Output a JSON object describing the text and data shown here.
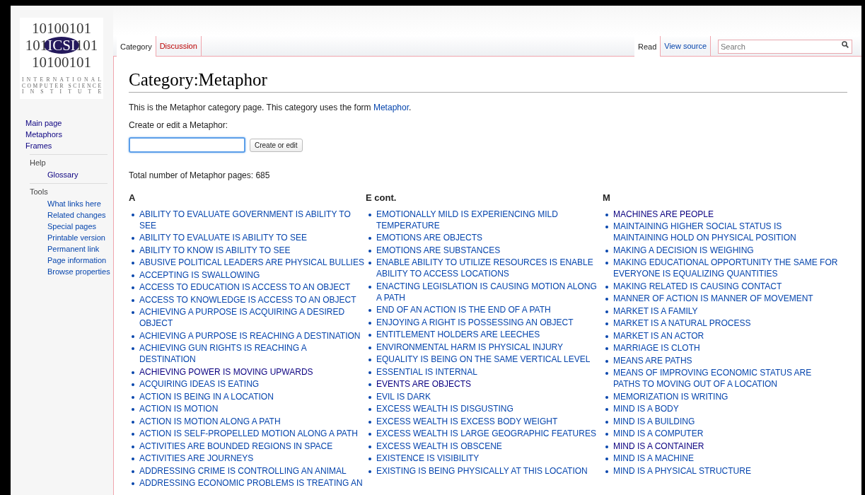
{
  "logo": {
    "rows": [
      "10100101",
      "10100101"
    ],
    "middle": [
      "101",
      "ICSI",
      "101"
    ],
    "caption": [
      "INTERNATIONAL",
      "COMPUTER SCIENCE",
      "INSTITUTE"
    ]
  },
  "sidebar": {
    "items": [
      {
        "label": "Main page",
        "visited": true
      },
      {
        "label": "Metaphors",
        "visited": true
      },
      {
        "label": "Frames",
        "visited": true
      }
    ],
    "sections": [
      {
        "heading": "Help",
        "items": [
          {
            "label": "Glossary",
            "visited": true
          }
        ]
      },
      {
        "heading": "Tools",
        "items": [
          {
            "label": "What links here",
            "visited": false
          },
          {
            "label": "Related changes",
            "visited": false
          },
          {
            "label": "Special pages",
            "visited": false
          },
          {
            "label": "Printable version",
            "visited": false
          },
          {
            "label": "Permanent link",
            "visited": false
          },
          {
            "label": "Page information",
            "visited": false
          },
          {
            "label": "Browse properties",
            "visited": false
          }
        ]
      }
    ]
  },
  "tabs_left": [
    {
      "label": "Category",
      "selected": true,
      "missing": false
    },
    {
      "label": "Discussion",
      "selected": false,
      "missing": true
    }
  ],
  "tabs_right": [
    {
      "label": "Read",
      "selected": true,
      "missing": false
    },
    {
      "label": "View source",
      "selected": false,
      "missing": false
    }
  ],
  "search": {
    "placeholder": "Search"
  },
  "title": "Category:Metaphor",
  "intro": {
    "before": "This is the Metaphor category page. This category uses the form ",
    "link": "Metaphor",
    "after": "."
  },
  "form": {
    "label": "Create or edit a Metaphor:",
    "focused": true,
    "button": "Create or edit"
  },
  "total": "Total number of Metaphor pages: 685",
  "columns": [
    {
      "heading": "A",
      "items": [
        {
          "label": "ABILITY TO EVALUATE GOVERNMENT IS ABILITY TO SEE",
          "visited": false
        },
        {
          "label": "ABILITY TO EVALUATE IS ABILITY TO SEE",
          "visited": false
        },
        {
          "label": "ABILITY TO KNOW IS ABILITY TO SEE",
          "visited": false
        },
        {
          "label": "ABUSIVE POLITICAL LEADERS ARE PHYSICAL BULLIES",
          "visited": false
        },
        {
          "label": "ACCEPTING IS SWALLOWING",
          "visited": false
        },
        {
          "label": "ACCESS TO EDUCATION IS ACCESS TO AN OBJECT",
          "visited": false
        },
        {
          "label": "ACCESS TO KNOWLEDGE IS ACCESS TO AN OBJECT",
          "visited": false
        },
        {
          "label": "ACHIEVING A PURPOSE IS ACQUIRING A DESIRED OBJECT",
          "visited": false
        },
        {
          "label": "ACHIEVING A PURPOSE IS REACHING A DESTINATION",
          "visited": false
        },
        {
          "label": "ACHIEVING GUN RIGHTS IS REACHING A DESTINATION",
          "visited": false
        },
        {
          "label": "ACHIEVING POWER IS MOVING UPWARDS",
          "visited": true
        },
        {
          "label": "ACQUIRING IDEAS IS EATING",
          "visited": false
        },
        {
          "label": "ACTION IS BEING IN A LOCATION",
          "visited": false
        },
        {
          "label": "ACTION IS MOTION",
          "visited": false
        },
        {
          "label": "ACTION IS MOTION ALONG A PATH",
          "visited": false
        },
        {
          "label": "ACTION IS SELF-PROPELLED MOTION ALONG A PATH",
          "visited": false
        },
        {
          "label": "ACTIVITIES ARE BOUNDED REGIONS IN SPACE",
          "visited": false
        },
        {
          "label": "ACTIVITIES ARE JOURNEYS",
          "visited": false
        },
        {
          "label": "ADDRESSING CRIME IS CONTROLLING AN ANIMAL",
          "visited": false
        },
        {
          "label": "ADDRESSING ECONOMIC PROBLEMS IS TREATING AN",
          "visited": false
        }
      ]
    },
    {
      "heading": "E cont.",
      "items": [
        {
          "label": "EMOTIONALLY MILD IS EXPERIENCING MILD TEMPERATURE",
          "visited": false
        },
        {
          "label": "EMOTIONS ARE OBJECTS",
          "visited": false
        },
        {
          "label": "EMOTIONS ARE SUBSTANCES",
          "visited": false
        },
        {
          "label": "ENABLE ABILITY TO UTILIZE RESOURCES IS ENABLE ABILITY TO ACCESS LOCATIONS",
          "visited": false
        },
        {
          "label": "ENACTING LEGISLATION IS CAUSING MOTION ALONG A PATH",
          "visited": false
        },
        {
          "label": "END OF AN ACTION IS THE END OF A PATH",
          "visited": false
        },
        {
          "label": "ENJOYING A RIGHT IS POSSESSING AN OBJECT",
          "visited": false
        },
        {
          "label": "ENTITLEMENT HOLDERS ARE LEECHES",
          "visited": false
        },
        {
          "label": "ENVIRONMENTAL HARM IS PHYSICAL INJURY",
          "visited": false
        },
        {
          "label": "EQUALITY IS BEING ON THE SAME VERTICAL LEVEL",
          "visited": false
        },
        {
          "label": "ESSENTIAL IS INTERNAL",
          "visited": false
        },
        {
          "label": "EVENTS ARE OBJECTS",
          "visited": true
        },
        {
          "label": "EVIL IS DARK",
          "visited": false
        },
        {
          "label": "EXCESS WEALTH IS DISGUSTING",
          "visited": false
        },
        {
          "label": "EXCESS WEALTH IS EXCESS BODY WEIGHT",
          "visited": false
        },
        {
          "label": "EXCESS WEALTH IS LARGE GEOGRAPHIC FEATURES",
          "visited": false
        },
        {
          "label": "EXCESS WEALTH IS OBSCENE",
          "visited": false
        },
        {
          "label": "EXISTENCE IS VISIBILITY",
          "visited": false
        },
        {
          "label": "EXISTING IS BEING PHYSICALLY AT THIS LOCATION",
          "visited": false
        }
      ]
    },
    {
      "heading": "M",
      "items": [
        {
          "label": "MACHINES ARE PEOPLE",
          "visited": true
        },
        {
          "label": "MAINTAINING HIGHER SOCIAL STATUS IS MAINTAINING HOLD ON PHYSICAL POSITION",
          "visited": false
        },
        {
          "label": "MAKING A DECISION IS WEIGHING",
          "visited": false
        },
        {
          "label": "MAKING EDUCATIONAL OPPORTUNITY THE SAME FOR EVERYONE IS EQUALIZING QUANTITIES",
          "visited": false
        },
        {
          "label": "MAKING RELATED IS CAUSING CONTACT",
          "visited": false
        },
        {
          "label": "MANNER OF ACTION IS MANNER OF MOVEMENT",
          "visited": false
        },
        {
          "label": "MARKET IS A FAMILY",
          "visited": false
        },
        {
          "label": "MARKET IS A NATURAL PROCESS",
          "visited": false
        },
        {
          "label": "MARKET IS AN ACTOR",
          "visited": false
        },
        {
          "label": "MARRIAGE IS CLOTH",
          "visited": false
        },
        {
          "label": "MEANS ARE PATHS",
          "visited": false
        },
        {
          "label": "MEANS OF IMPROVING ECONOMIC STATUS ARE PATHS TO MOVING OUT OF A LOCATION",
          "visited": false
        },
        {
          "label": "MEMORIZATION IS WRITING",
          "visited": false
        },
        {
          "label": "MIND IS A BODY",
          "visited": false
        },
        {
          "label": "MIND IS A BUILDING",
          "visited": false
        },
        {
          "label": "MIND IS A COMPUTER",
          "visited": false
        },
        {
          "label": "MIND IS A CONTAINER",
          "visited": true
        },
        {
          "label": "MIND IS A MACHINE",
          "visited": false
        },
        {
          "label": "MIND IS A PHYSICAL STRUCTURE",
          "visited": false
        }
      ]
    }
  ]
}
